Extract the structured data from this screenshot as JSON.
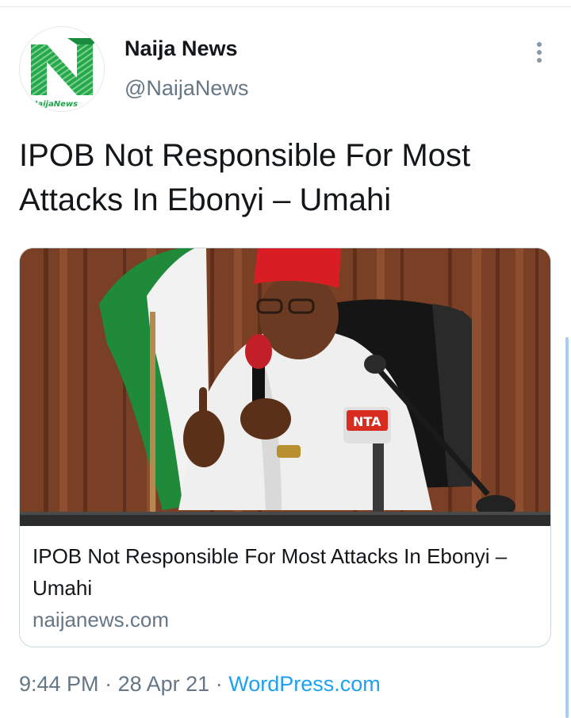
{
  "tweet": {
    "user": {
      "name": "Naija News",
      "handle": "@NaijaNews",
      "avatar_text": "NaijaNews"
    },
    "text_line1": "IPOB Not Responsible For Most",
    "text_line2": "Attacks In Ebonyi – Umahi",
    "card": {
      "image_mic_label": "NTA",
      "headline": "IPOB Not Responsible For Most Attacks In Ebonyi – Umahi",
      "domain": "naijanews.com"
    },
    "meta": {
      "time": "9:44 PM",
      "separator": "·",
      "date": "28 Apr 21",
      "source": "WordPress.com"
    }
  },
  "colors": {
    "brand_green": "#1fa34a",
    "link_blue": "#1da1f2",
    "secondary_text": "#657786"
  },
  "icons": {
    "more": "more-vertical-icon"
  }
}
